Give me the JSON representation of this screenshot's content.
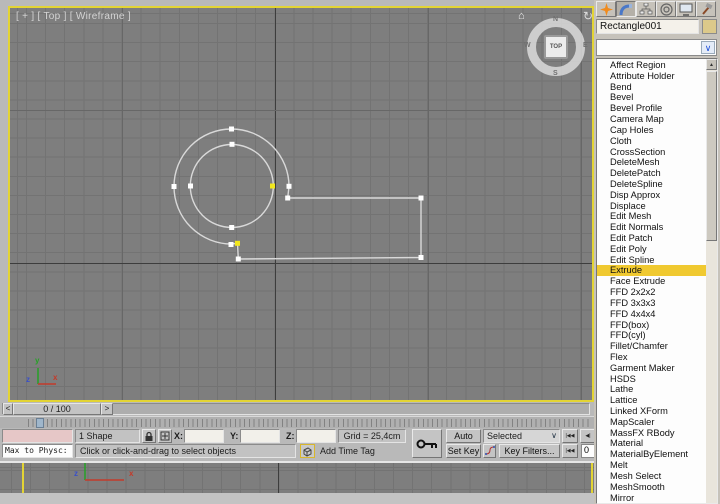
{
  "viewport": {
    "label": "[ + ] [ Top ] [ Wireframe ]",
    "viewcube": {
      "center": "TOP",
      "n": "N",
      "s": "S",
      "e": "E",
      "w": "W",
      "home_icon": "⌂",
      "rotate_icon": "↻"
    },
    "axis_tripod": {
      "x": "x",
      "y": "y",
      "z": "z"
    }
  },
  "bottom_viewport": {
    "axis_tripod": {
      "x": "x",
      "z": "z"
    }
  },
  "timeline": {
    "frame_display": "0 / 100",
    "step_back": "<",
    "step_forward": ">"
  },
  "status_bar": {
    "listener_text": "Max to Physc:",
    "selection_status": "1 Shape Selected",
    "prompt": "Click or click-and-drag to select objects",
    "coord_labels": {
      "x": "X:",
      "y": "Y:",
      "z": "Z:"
    },
    "coord_values": {
      "x": "",
      "y": "",
      "z": ""
    },
    "grid_size": "Grid = 25,4cm",
    "add_time_tag": "Add Time Tag",
    "auto_key": "Auto Key",
    "set_key": "Set Key",
    "selection_set": "Selected",
    "selection_set_arrow": "∨",
    "key_filters": "Key Filters...",
    "frame_number": "0",
    "go_to_start_icon": "|◀◀",
    "previous_frame_icon": "◀|",
    "scroll_up_icon": "▲"
  },
  "command_panel": {
    "object_name": "Rectangle001",
    "modifier_list": {
      "selected": "Extrude",
      "items": [
        "Affect Region",
        "Attribute Holder",
        "Bend",
        "Bevel",
        "Bevel Profile",
        "Camera Map",
        "Cap Holes",
        "Cloth",
        "CrossSection",
        "DeleteMesh",
        "DeletePatch",
        "DeleteSpline",
        "Disp Approx",
        "Displace",
        "Edit Mesh",
        "Edit Normals",
        "Edit Patch",
        "Edit Poly",
        "Edit Spline",
        "Extrude",
        "Face Extrude",
        "FFD 2x2x2",
        "FFD 3x3x3",
        "FFD 4x4x4",
        "FFD(box)",
        "FFD(cyl)",
        "Fillet/Chamfer",
        "Flex",
        "Garment Maker",
        "HSDS",
        "Lathe",
        "Lattice",
        "Linked XForm",
        "MapScaler",
        "MassFX RBody",
        "Material",
        "MaterialByElement",
        "Melt",
        "Mesh Select",
        "MeshSmooth",
        "Mirror"
      ]
    }
  }
}
